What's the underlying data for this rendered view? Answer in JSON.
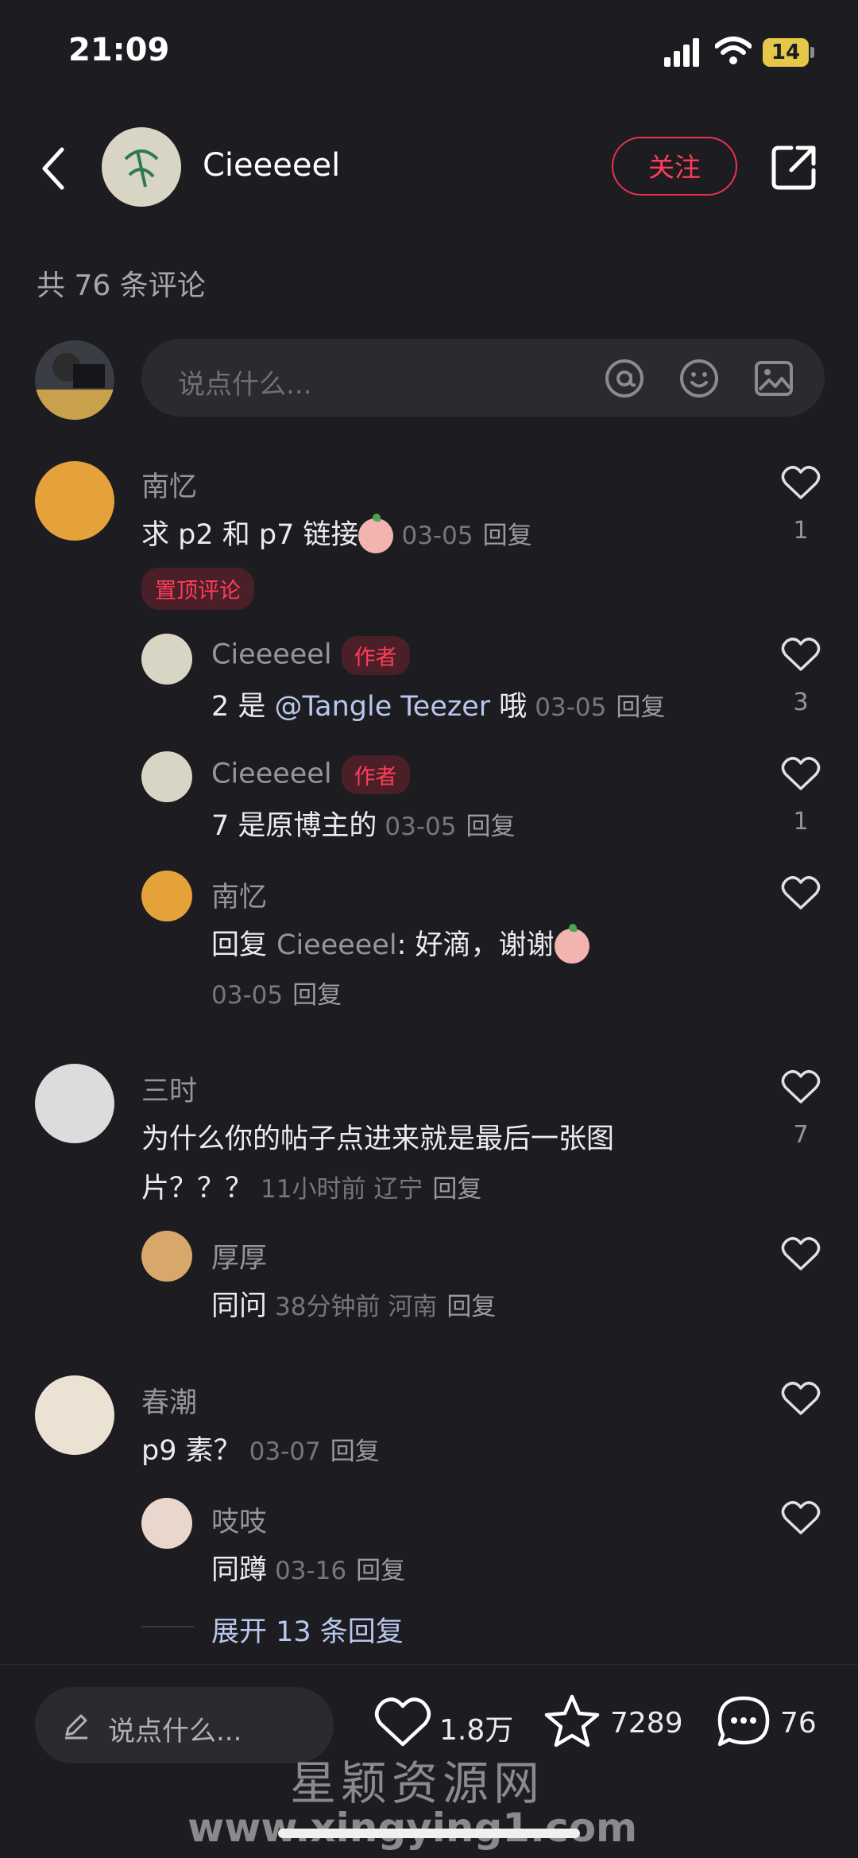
{
  "status": {
    "time": "21:09",
    "battery": "14"
  },
  "header": {
    "username": "Cieeeeel",
    "follow_label": "关注"
  },
  "comments_count": "共 76 条评论",
  "input": {
    "placeholder": "说点什么..."
  },
  "comments": [
    {
      "name": "南忆",
      "text": "求 p2 和 p7 链接",
      "meta": "03-05",
      "reply": "回复",
      "likes": "1",
      "pinned_label": "置顶评论",
      "replies": [
        {
          "name": "Cieeeeel",
          "badge": "作者",
          "text_prefix": "2 是 ",
          "mention": "@Tangle Teezer",
          "text_suffix": " 哦",
          "meta": "03-05",
          "reply": "回复",
          "likes": "3"
        },
        {
          "name": "Cieeeeel",
          "badge": "作者",
          "text": "7 是原博主的",
          "meta": "03-05",
          "reply": "回复",
          "likes": "1"
        },
        {
          "name": "南忆",
          "reply_to_label": "回复",
          "reply_to_user": "Cieeeeel",
          "text": ": 好滴，谢谢",
          "meta": "03-05",
          "reply": "回复"
        }
      ]
    },
    {
      "name": "三时",
      "text_line1": "为什么你的帖子点进来就是最后一张图",
      "text_line2": "片？？？",
      "meta": "11小时前 辽宁",
      "reply": "回复",
      "likes": "7",
      "replies": [
        {
          "name": "厚厚",
          "text": "同问",
          "meta": "38分钟前 河南",
          "reply": "回复"
        }
      ]
    },
    {
      "name": "春潮",
      "text": "p9 素？",
      "meta": "03-07",
      "reply": "回复",
      "replies": [
        {
          "name": "吱吱",
          "text": "同蹲",
          "meta": "03-16",
          "reply": "回复"
        }
      ],
      "expand_label": "展开 13 条回复"
    }
  ],
  "bottom_bar": {
    "placeholder": "说点什么...",
    "likes": "1.8万",
    "favorites": "7289",
    "comments": "76"
  },
  "watermark": {
    "line1": "星颖资源网",
    "line2": "www.xingying1.com"
  },
  "colors": {
    "accent": "#ff3d5a",
    "background": "#1c1c21",
    "mention": "#b9c7ec"
  }
}
